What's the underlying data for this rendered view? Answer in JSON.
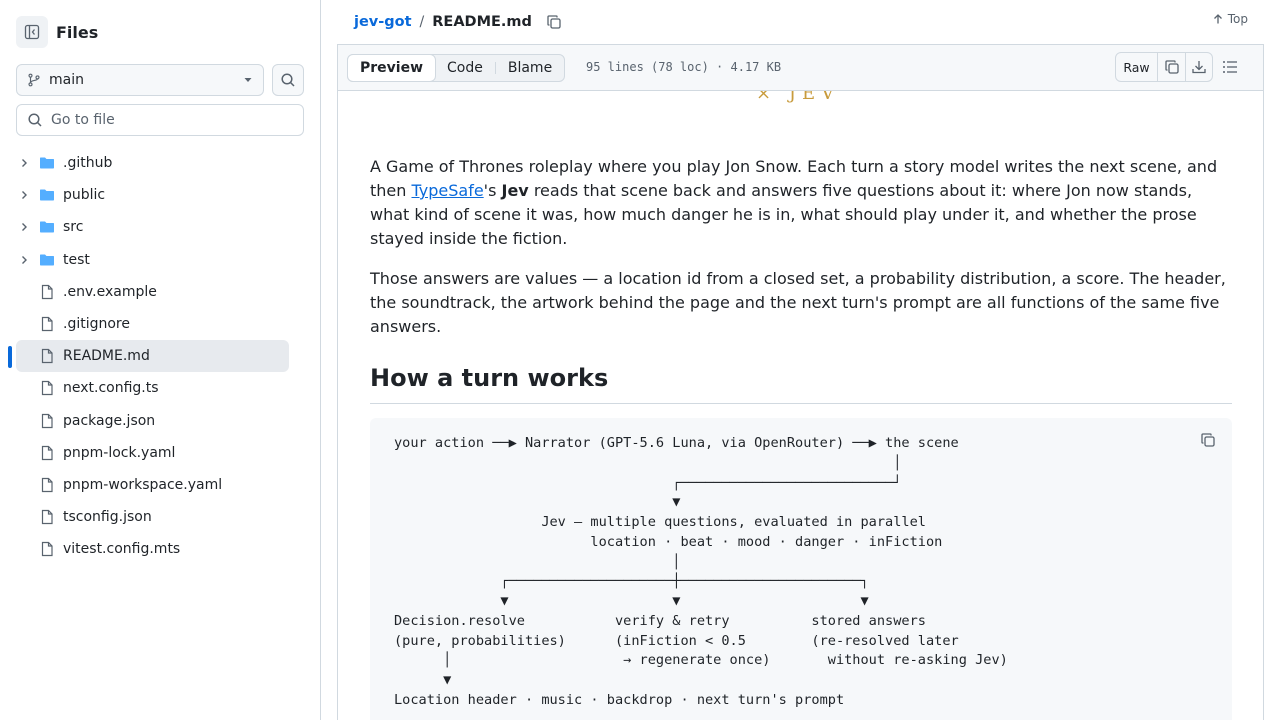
{
  "sidebar": {
    "title": "Files",
    "branch": "main",
    "go_to_file_placeholder": "Go to file",
    "items": [
      {
        "type": "folder",
        "name": ".github"
      },
      {
        "type": "folder",
        "name": "public"
      },
      {
        "type": "folder",
        "name": "src"
      },
      {
        "type": "folder",
        "name": "test"
      },
      {
        "type": "file",
        "name": ".env.example"
      },
      {
        "type": "file",
        "name": ".gitignore"
      },
      {
        "type": "file",
        "name": "README.md",
        "selected": true
      },
      {
        "type": "file",
        "name": "next.config.ts"
      },
      {
        "type": "file",
        "name": "package.json"
      },
      {
        "type": "file",
        "name": "pnpm-lock.yaml"
      },
      {
        "type": "file",
        "name": "pnpm-workspace.yaml"
      },
      {
        "type": "file",
        "name": "tsconfig.json"
      },
      {
        "type": "file",
        "name": "vitest.config.mts"
      }
    ]
  },
  "header": {
    "repo": "jev-got",
    "separator": "/",
    "file": "README.md",
    "top_label": "Top"
  },
  "file_header": {
    "tabs": [
      "Preview",
      "Code",
      "Blame"
    ],
    "active_tab": "Preview",
    "meta": "95 lines (78 loc) · 4.17 KB",
    "raw_label": "Raw"
  },
  "content": {
    "banner_tail": "× JEV",
    "p1_before_link": "A Game of Thrones roleplay where you play Jon Snow. Each turn a story model writes the next scene, and then ",
    "p1_link": "TypeSafe",
    "p1_middle": "'s ",
    "p1_bold": "Jev",
    "p1_after": " reads that scene back and answers five questions about it: where Jon now stands, what kind of scene it was, how much danger he is in, what should play under it, and whether the prose stayed inside the fiction.",
    "p2": "Those answers are values — a location id from a closed set, a probability distribution, a score. The header, the soundtrack, the artwork behind the page and the next turn's prompt are all functions of the same five answers.",
    "h2": "How a turn works",
    "code": "your action ──▶ Narrator (GPT-5.6 Luna, via OpenRouter) ──▶ the scene\n                                                             │\n                                  ┌──────────────────────────┘\n                                  ▼\n                  Jev — multiple questions, evaluated in parallel\n                        location · beat · mood · danger · inFiction\n                                  │\n             ┌────────────────────┼──────────────────────┐\n             ▼                    ▼                      ▼\nDecision.resolve           verify & retry          stored answers\n(pure, probabilities)      (inFiction < 0.5        (re-resolved later\n      │                     → regenerate once)       without re-asking Jev)\n      ▼\nLocation header · music · backdrop · next turn's prompt"
  }
}
